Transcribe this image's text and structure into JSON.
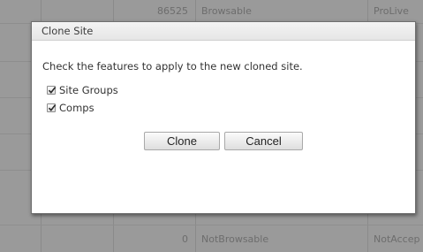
{
  "background_table": {
    "top_row": {
      "count": "86525",
      "browsable": "Browsable",
      "status": "ProLive"
    },
    "bottom_row": {
      "count": "0",
      "browsable": "NotBrowsable",
      "status": "NotAccep"
    }
  },
  "dialog": {
    "title": "Clone Site",
    "message": "Check the features to apply to the new cloned site.",
    "options": [
      {
        "label": "Site Groups",
        "checked": true
      },
      {
        "label": "Comps",
        "checked": true
      }
    ],
    "buttons": {
      "clone": "Clone",
      "cancel": "Cancel"
    }
  }
}
